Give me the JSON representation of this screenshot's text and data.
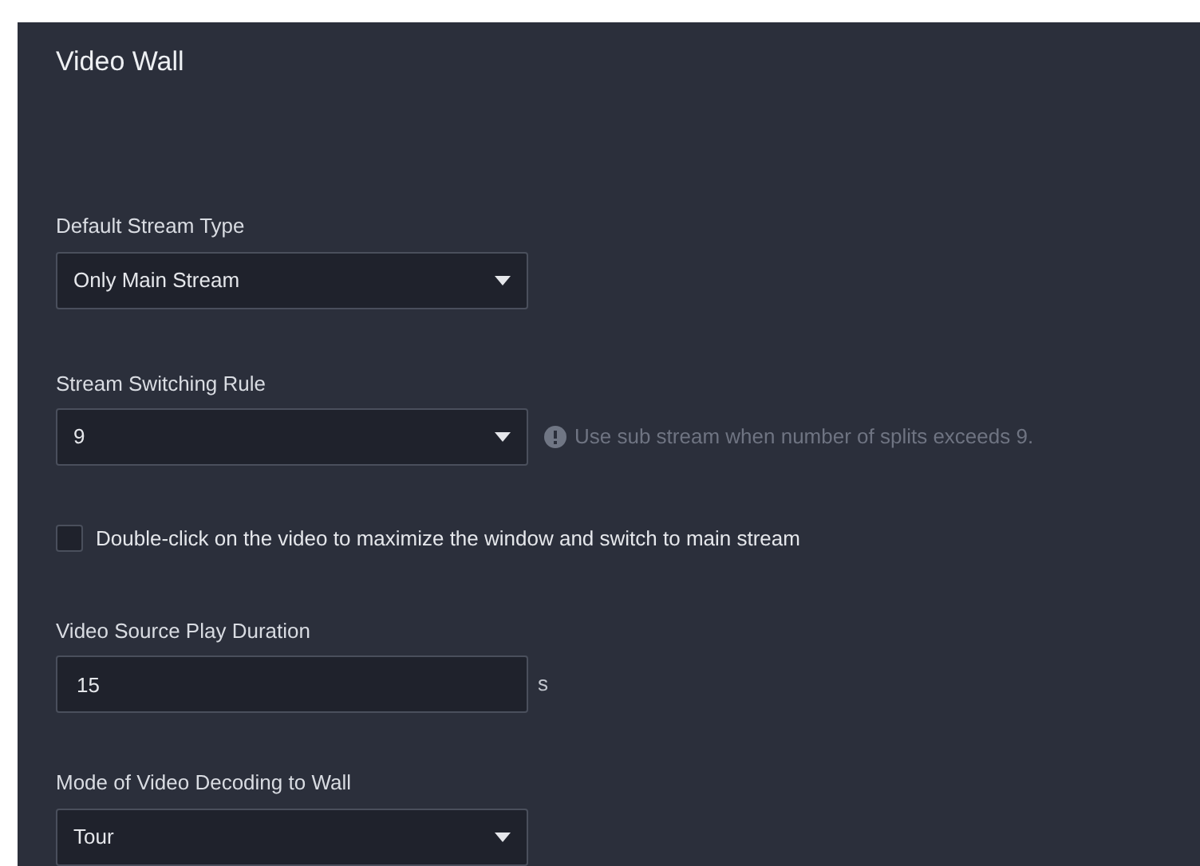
{
  "panel": {
    "title": "Video Wall"
  },
  "fields": [
    {
      "kind": "select",
      "label": "Default Stream Type",
      "value": "Only Main Stream"
    },
    {
      "kind": "select",
      "label": "Stream Switching Rule",
      "value": "9",
      "hint": "Use sub stream when number of splits exceeds 9."
    },
    {
      "kind": "checkbox",
      "label": "Double-click on the video to maximize the window and switch to main stream",
      "checked": false
    },
    {
      "kind": "input",
      "label": "Video Source Play Duration",
      "value": "15",
      "unit": "s"
    },
    {
      "kind": "select",
      "label": "Mode of Video Decoding to Wall",
      "value": "Tour"
    }
  ]
}
